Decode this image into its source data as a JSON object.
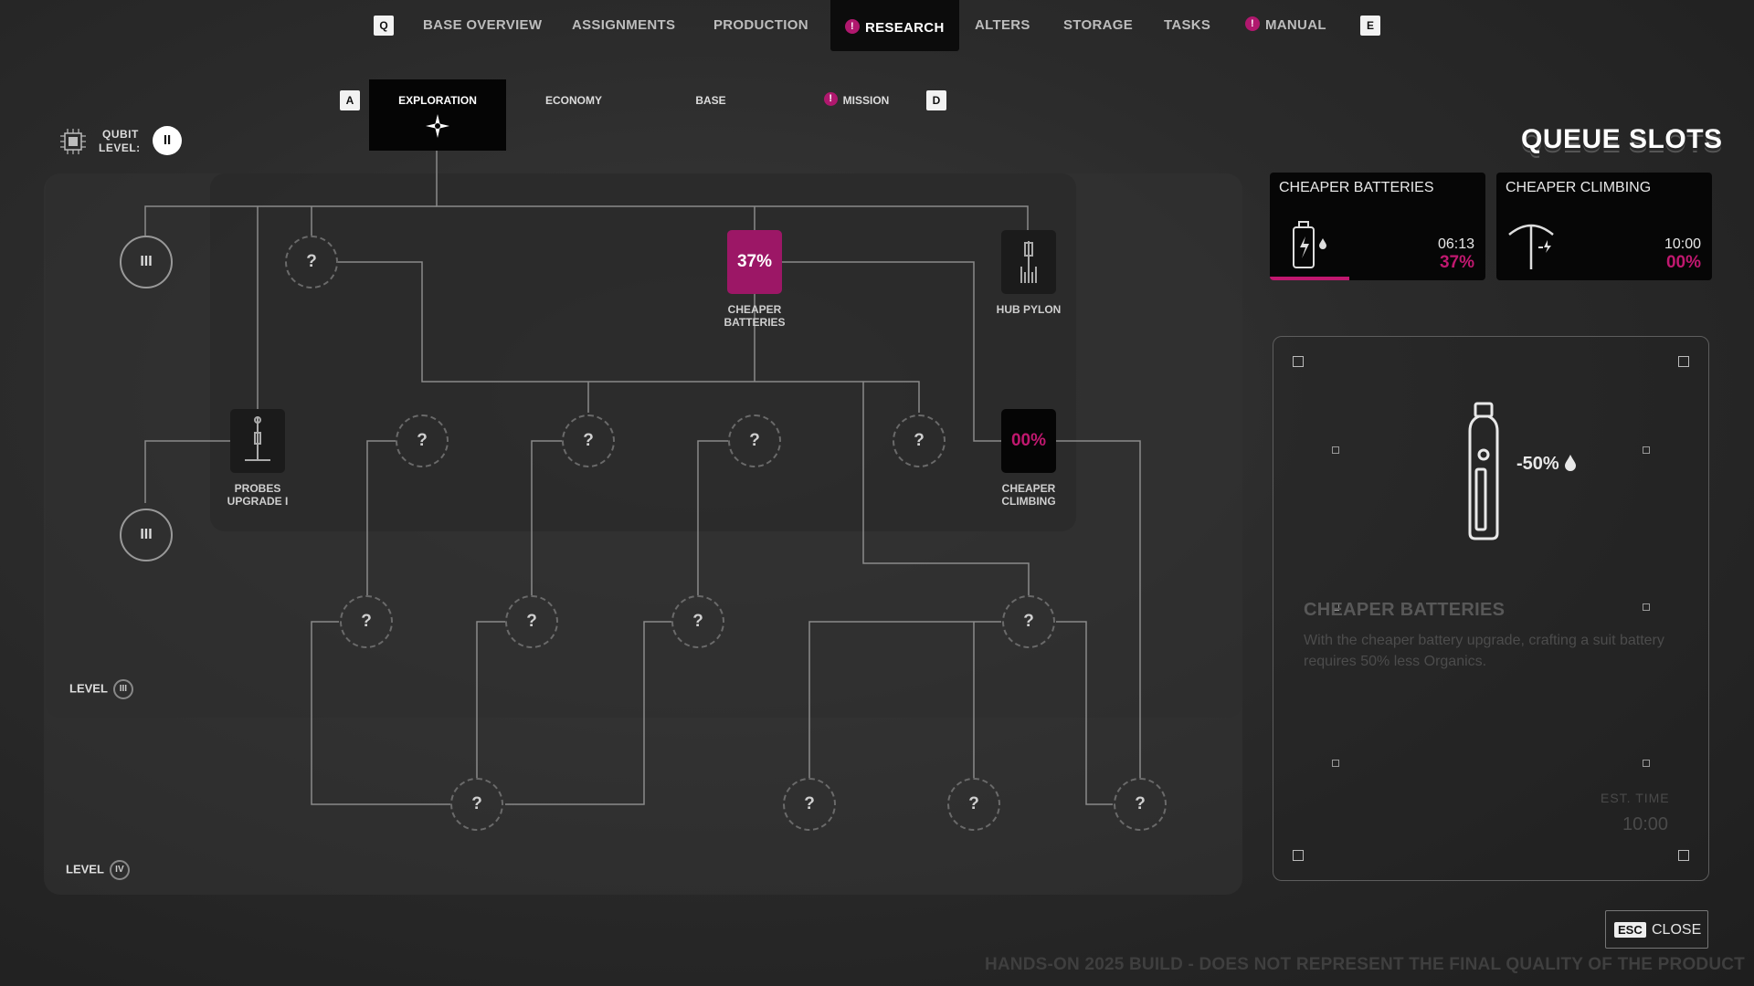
{
  "nav": {
    "left_key": "Q",
    "right_key": "E",
    "items": [
      "BASE OVERVIEW",
      "ASSIGNMENTS",
      "PRODUCTION",
      "RESEARCH",
      "ALTERS",
      "STORAGE",
      "TASKS",
      "MANUAL"
    ],
    "active": "RESEARCH",
    "alert_glyph": "!"
  },
  "subtabs": {
    "left_key": "A",
    "right_key": "D",
    "items": [
      "EXPLORATION",
      "ECONOMY",
      "BASE",
      "MISSION"
    ],
    "active": "EXPLORATION"
  },
  "qubit": {
    "label_line1": "QUBIT",
    "label_line2": "LEVEL:",
    "level": "II"
  },
  "tree": {
    "tier_badge": "III",
    "levels": [
      {
        "label": "LEVEL",
        "numeral": "III"
      },
      {
        "label": "LEVEL",
        "numeral": "IV"
      }
    ],
    "unknown_glyph": "?",
    "nodes": {
      "cheaper_batteries": {
        "name_line1": "CHEAPER",
        "name_line2": "BATTERIES",
        "progress": "37%"
      },
      "hub_pylon": {
        "name": "HUB PYLON"
      },
      "probes_upgrade": {
        "name_line1": "PROBES",
        "name_line2": "UPGRADE I"
      },
      "cheaper_climbing": {
        "name_line1": "CHEAPER",
        "name_line2": "CLIMBING",
        "progress": "00%"
      }
    }
  },
  "queue": {
    "title": "QUEUE SLOTS",
    "slots": [
      {
        "name": "CHEAPER BATTERIES",
        "time": "06:13",
        "progress": "37%",
        "progress_fraction": 0.37
      },
      {
        "name": "CHEAPER CLIMBING",
        "time": "10:00",
        "progress": "00%",
        "progress_fraction": 0.0
      }
    ]
  },
  "detail": {
    "effect": "-50%",
    "title": "CHEAPER BATTERIES",
    "description": "With the cheaper battery upgrade, crafting a suit battery requires 50% less Organics.",
    "est_label": "EST. TIME",
    "est_value": "10:00"
  },
  "close": {
    "key": "ESC",
    "label": "CLOSE"
  },
  "footer_note": "HANDS-ON 2025 BUILD - DOES NOT REPRESENT THE FINAL QUALITY OF THE PRODUCT",
  "colors": {
    "accent": "#c0186f",
    "accent_dark": "#9c1766",
    "background": "#2b2b2b"
  }
}
